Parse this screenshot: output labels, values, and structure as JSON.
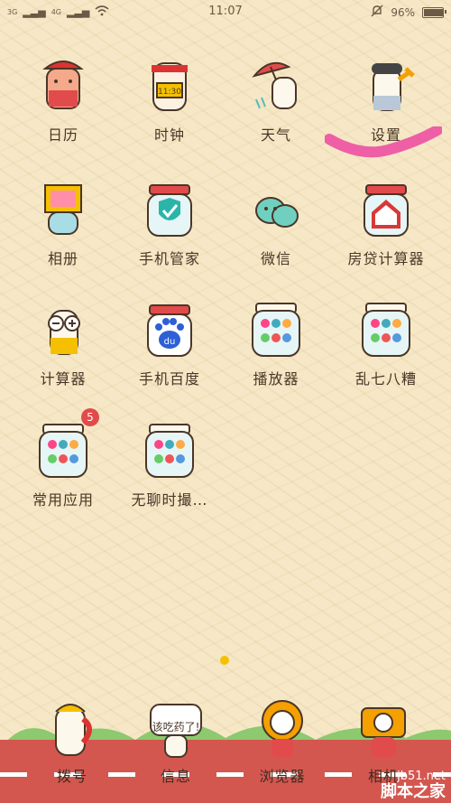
{
  "status_bar": {
    "network": "3G",
    "network2": "4G",
    "time": "11:07",
    "battery": "96%",
    "battery_level": 0.96
  },
  "apps": [
    {
      "label": "日历",
      "icon": "calendar-icon"
    },
    {
      "label": "时钟",
      "icon": "clock-icon"
    },
    {
      "label": "天气",
      "icon": "weather-icon"
    },
    {
      "label": "设置",
      "icon": "settings-icon"
    },
    {
      "label": "相册",
      "icon": "gallery-icon"
    },
    {
      "label": "手机管家",
      "icon": "phone-manager-icon"
    },
    {
      "label": "微信",
      "icon": "wechat-icon"
    },
    {
      "label": "房贷计算器",
      "icon": "mortgage-calculator-icon"
    },
    {
      "label": "计算器",
      "icon": "calculator-icon"
    },
    {
      "label": "手机百度",
      "icon": "baidu-icon"
    },
    {
      "label": "播放器",
      "icon": "player-folder-icon"
    },
    {
      "label": "乱七八糟",
      "icon": "misc-folder-icon"
    },
    {
      "label": "常用应用",
      "icon": "common-apps-folder-icon",
      "badge": "5"
    },
    {
      "label": "无聊时撮…",
      "icon": "bored-folder-icon"
    }
  ],
  "dock": [
    {
      "label": "拨号",
      "icon": "phone-icon"
    },
    {
      "label": "信息",
      "icon": "message-icon",
      "bubble": "该吃药了!"
    },
    {
      "label": "浏览器",
      "icon": "browser-icon"
    },
    {
      "label": "相机",
      "icon": "camera-icon"
    }
  ],
  "watermark": {
    "line1": "jb51.net",
    "line2": "脚本之家"
  }
}
